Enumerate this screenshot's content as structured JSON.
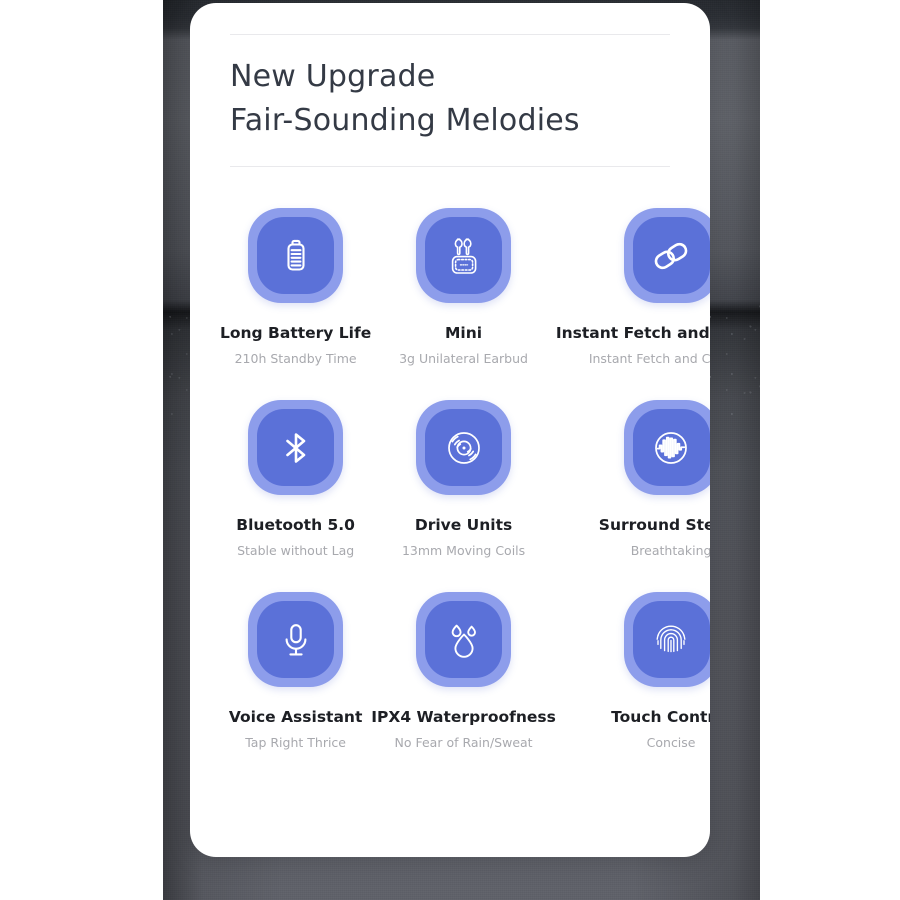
{
  "card": {
    "heading_lines": [
      "New Upgrade",
      "Fair-Sounding Melodies"
    ],
    "accent_outer": "#8d9deb",
    "accent_inner": "#5b71d8",
    "title_color": "#1d1f24",
    "subtitle_color": "#a8a9ae",
    "heading_color": "#343a45",
    "divider_color": "#e9e9ec",
    "backdrop_color": "#5f6169"
  },
  "features": [
    {
      "icon": "battery-icon",
      "title": "Long Battery Life",
      "subtitle": "210h Standby Time"
    },
    {
      "icon": "earbuds-case-icon",
      "title": "Mini",
      "subtitle": "3g Unilateral Earbud"
    },
    {
      "icon": "chain-link-icon",
      "title": "Instant Fetch and Connect",
      "subtitle": "Instant Fetch and Connect"
    },
    {
      "icon": "bluetooth-icon",
      "title": "Bluetooth 5.0",
      "subtitle": "Stable without Lag"
    },
    {
      "icon": "vinyl-record-icon",
      "title": "Drive Units",
      "subtitle": "13mm Moving Coils"
    },
    {
      "icon": "sound-wave-circle-icon",
      "title": "Surround Stereo",
      "subtitle": "Breathtaking"
    },
    {
      "icon": "microphone-icon",
      "title": "Voice Assistant",
      "subtitle": "Tap Right Thrice"
    },
    {
      "icon": "water-drop-icon",
      "title": "IPX4 Waterproofness",
      "subtitle": "No Fear of Rain/Sweat"
    },
    {
      "icon": "fingerprint-icon",
      "title": "Touch Control",
      "subtitle": "Concise"
    }
  ]
}
